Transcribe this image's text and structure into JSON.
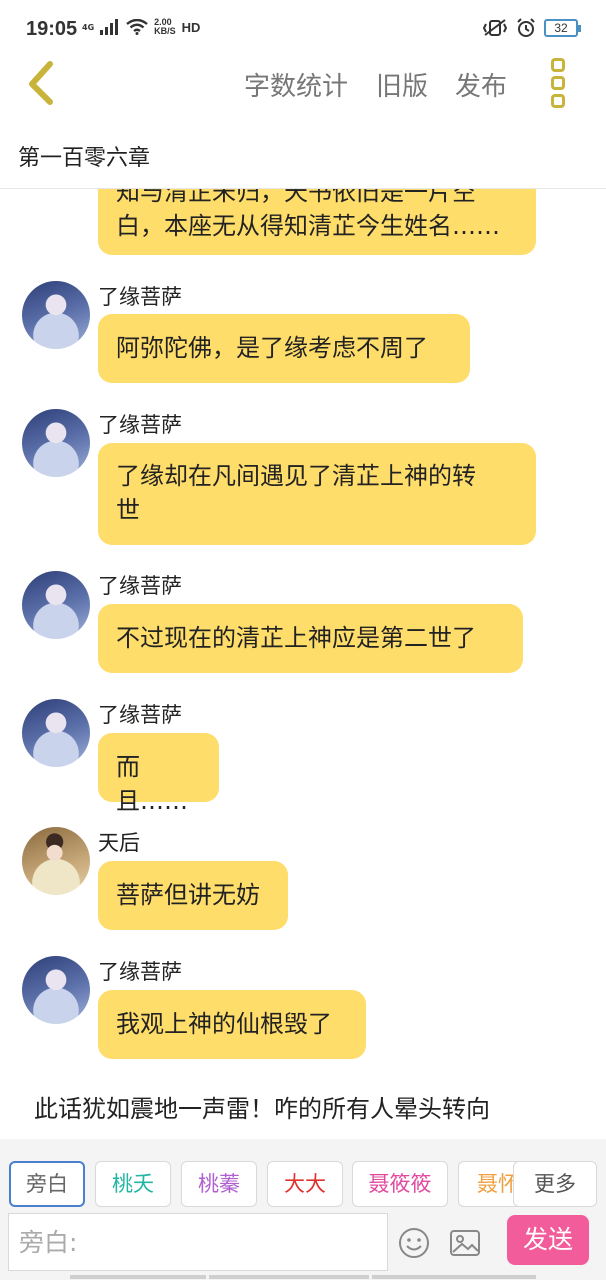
{
  "status_bar": {
    "time": "19:05",
    "network": "4G",
    "speed_value": "2.00",
    "speed_unit": "KB/S",
    "hd": "HD",
    "battery": "32"
  },
  "nav": {
    "word_count": "字数统计",
    "old_version": "旧版",
    "publish": "发布",
    "accent_color": "#c8b43a"
  },
  "chapter": {
    "title": "第一百零六章"
  },
  "messages": [
    {
      "lines": [
        "知与清芷未归，天书依旧是一片空",
        "白，本座无从得知清芷今生姓名……"
      ]
    },
    {
      "sender": "了缘菩萨",
      "lines": [
        "阿弥陀佛，是了缘考虑不周了"
      ]
    },
    {
      "sender": "了缘菩萨",
      "lines": [
        "了缘却在凡间遇见了清芷上神的转",
        "世"
      ]
    },
    {
      "sender": "了缘菩萨",
      "lines": [
        "不过现在的清芷上神应是第二世了"
      ]
    },
    {
      "sender": "了缘菩萨",
      "lines": [
        "而且……"
      ]
    },
    {
      "sender": "天后",
      "lines": [
        "菩萨但讲无妨"
      ]
    },
    {
      "sender": "了缘菩萨",
      "lines": [
        "我观上神的仙根毁了"
      ]
    }
  ],
  "narration": "此话犹如震地一声雷！咋的所有人晕头转向",
  "characters": {
    "narration": "旁白",
    "taoyao": "桃夭",
    "taozhen": "桃蓁",
    "dada": "大大",
    "niexx": "聂筱筱",
    "niehuai": "聂怀",
    "more": "更多"
  },
  "composer": {
    "placeholder": "旁白:",
    "send": "发送",
    "send_color": "#f25c9a"
  },
  "bubble_color": "#fedd6a"
}
